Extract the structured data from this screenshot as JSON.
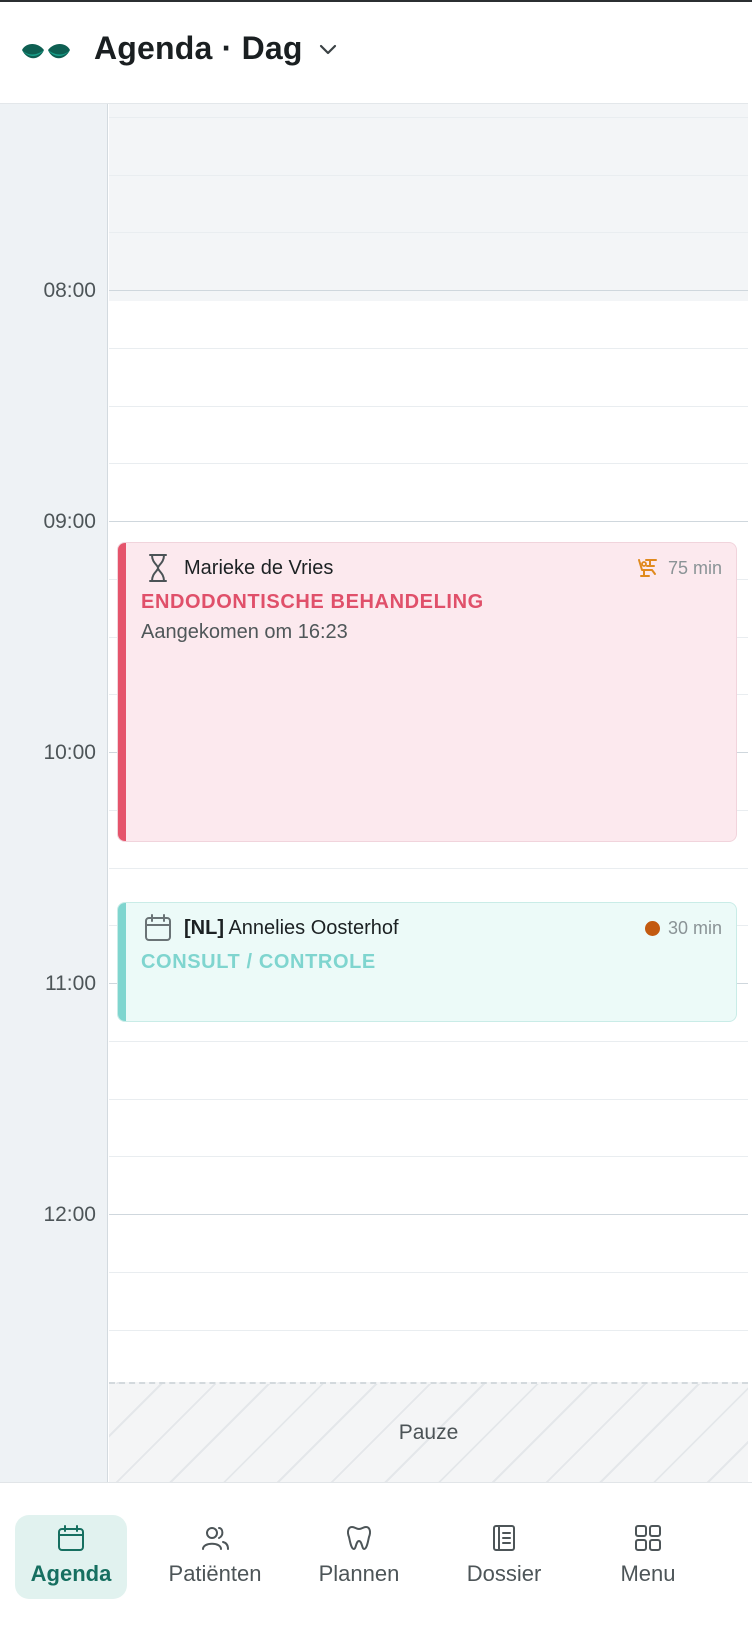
{
  "header": {
    "title": "Agenda · Dag"
  },
  "calendar": {
    "hours": [
      "08:00",
      "09:00",
      "10:00",
      "11:00",
      "12:00"
    ],
    "pause_label": "Pauze"
  },
  "appointments": [
    {
      "patient": "Marieke de Vries",
      "treatment": "ENDODONTISCHE BEHANDELING",
      "status": "Aangekomen om 16:23",
      "duration": "75 min",
      "left_icon": "hourglass-icon",
      "right_icon": "dental-chair-icon",
      "color": "#e5546b"
    },
    {
      "language_tag": "[NL]",
      "patient": "Annelies Oosterhof",
      "treatment": "CONSULT / CONTROLE",
      "duration": "30 min",
      "left_icon": "calendar-icon",
      "right_icon": "status-dot",
      "color": "#7fd5cf",
      "dot_color": "#c35a10"
    }
  ],
  "nav": [
    {
      "label": "Agenda",
      "icon": "calendar-icon",
      "active": true
    },
    {
      "label": "Patiënten",
      "icon": "users-icon",
      "active": false
    },
    {
      "label": "Plannen",
      "icon": "tooth-icon",
      "active": false
    },
    {
      "label": "Dossier",
      "icon": "notebook-icon",
      "active": false
    },
    {
      "label": "Menu",
      "icon": "grid-icon",
      "active": false
    }
  ],
  "colors": {
    "accent": "#166f60",
    "active_nav_bg": "#e1f2ef",
    "endo": "#e5546b",
    "consult": "#7fd5cf"
  }
}
